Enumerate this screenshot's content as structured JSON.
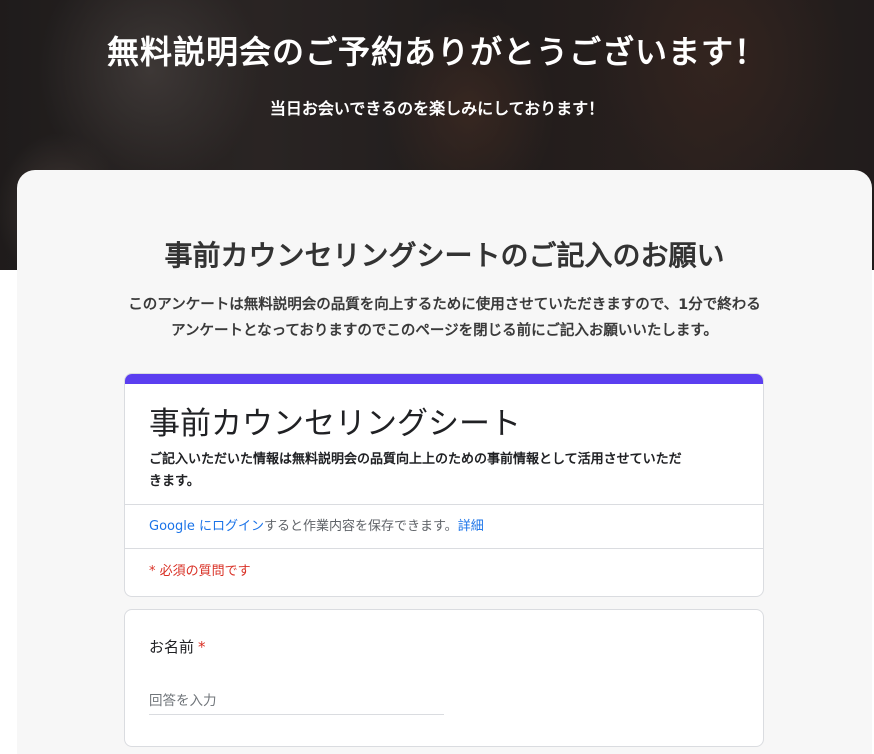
{
  "hero": {
    "title": "無料説明会のご予約ありがとうございます！",
    "subtitle": "当日お会いできるのを楽しみにしております！"
  },
  "card": {
    "heading": "事前カウンセリングシートのご記入のお願い",
    "description_line1": "このアンケートは無料説明会の品質を向上するために使用させていただきますので、1分で終わる",
    "description_line2": "アンケートとなっておりますのでこのページを閉じる前にご記入お願いいたします。"
  },
  "form": {
    "accent_color": "#5b3ef0",
    "title": "事前カウンセリングシート",
    "description_line1": "ご記入いただいた情報は無料説明会の品質向上上のための事前情報として活用させていただ",
    "description_line2": "きます。",
    "login_link": "Google にログイン",
    "login_text": "すると作業内容を保存できます。",
    "details_link": "詳細",
    "required_note": "* 必須の質問です"
  },
  "question": {
    "label": "お名前",
    "required_mark": "*",
    "placeholder": "回答を入力",
    "value": ""
  }
}
